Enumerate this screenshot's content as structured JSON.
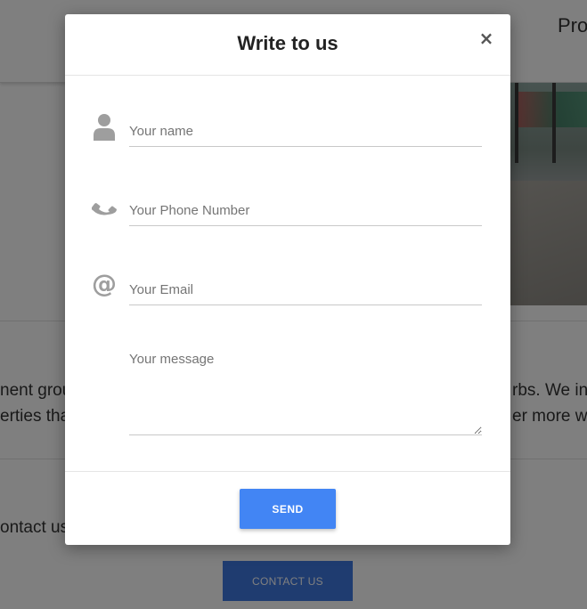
{
  "background": {
    "nav_item": "Pro",
    "paragraph_left_line1": "nent grou",
    "paragraph_left_line2": "erties tha",
    "paragraph_right_line1": "rbs. We in",
    "paragraph_right_line2": "er more wa",
    "contact_text": "ontact us",
    "contact_button": "CONTACT US"
  },
  "modal": {
    "title": "Write to us",
    "close_label": "×",
    "fields": {
      "name_placeholder": "Your name",
      "phone_placeholder": "Your Phone Number",
      "email_placeholder": "Your Email",
      "message_placeholder": "Your message"
    },
    "send_label": "SEND"
  },
  "icons": {
    "name": "user-icon",
    "phone": "phone-icon",
    "email": "at-sign-icon",
    "close": "close-icon"
  },
  "colors": {
    "accent": "#4285f4",
    "contact_button": "#3f78e0",
    "icon": "#9e9e9e",
    "overlay": "rgba(0,0,0,0.5)"
  }
}
